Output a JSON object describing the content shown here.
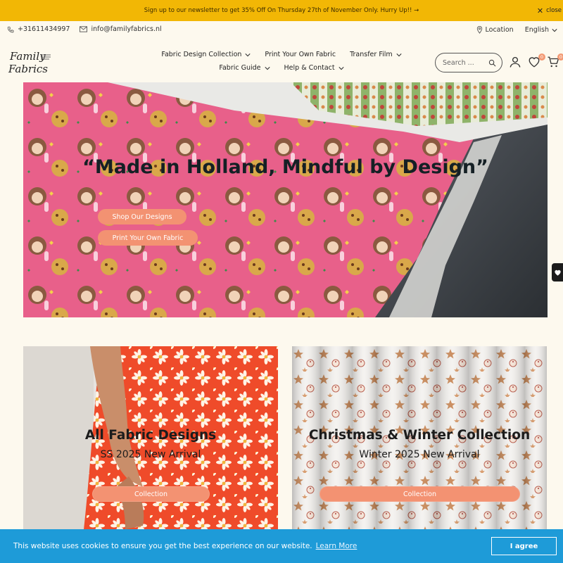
{
  "announcement": {
    "text": "Sign up to our newsletter to get 35% Off On Thursday 27th of November Only. Hurry Up!! →",
    "close_label": "close"
  },
  "contact": {
    "phone": "+31611434997",
    "email": "info@familyfabrics.nl"
  },
  "topbar_right": {
    "location": "Location",
    "language": "English"
  },
  "nav": {
    "items": [
      {
        "label": "Fabric Design Collection",
        "dropdown": true
      },
      {
        "label": "Print Your Own Fabric",
        "dropdown": false
      },
      {
        "label": "Transfer Film",
        "dropdown": true
      },
      {
        "label": "Fabric Guide",
        "dropdown": true
      },
      {
        "label": "Help & Contact",
        "dropdown": true
      }
    ]
  },
  "search": {
    "placeholder": "Search ..."
  },
  "header_icons": {
    "wishlist_count": "0",
    "cart_count": "0"
  },
  "hero": {
    "title": "“Made in Holland, Mindful by Design”",
    "primary_button": "Shop Our Designs",
    "secondary_button": "Print Your Own Fabric"
  },
  "collections": [
    {
      "title": "All Fabric Designs",
      "subtitle": "SS 2025 New Arrival",
      "button": "Collection"
    },
    {
      "title": "Christmas & Winter Collection",
      "subtitle": "Winter 2025 New Arrival",
      "button": "Collection"
    }
  ],
  "cookie": {
    "message": "This website uses cookies to ensure you get the best experience on our website.",
    "learn_more": "Learn More",
    "agree": "I agree"
  },
  "colors": {
    "announcement_bg": "#f2b705",
    "accent_button": "#f39272",
    "cookie_bg": "#1e9bd8",
    "page_bg": "#fdf9ee"
  }
}
